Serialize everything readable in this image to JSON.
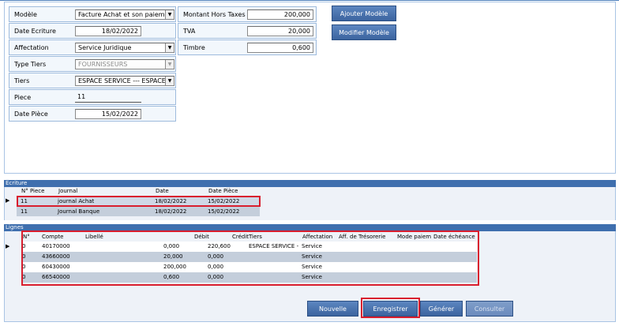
{
  "form": {
    "modele": {
      "label": "Modèle",
      "value": "Facture Achat et son paiement"
    },
    "date_ecriture": {
      "label": "Date Ecriture",
      "value": "18/02/2022"
    },
    "affectation": {
      "label": "Affectation",
      "value": "Service Juridique"
    },
    "type_tiers": {
      "label": "Type Tiers",
      "value": "FOURNISSEURS"
    },
    "tiers": {
      "label": "Tiers",
      "value": "ESPACE SERVICE --- ESPACE S"
    },
    "piece": {
      "label": "Piece",
      "value": "11"
    },
    "date_piece": {
      "label": "Date Pièce",
      "value": "15/02/2022"
    },
    "montant_ht": {
      "label": "Montant Hors Taxes",
      "value": "200,000"
    },
    "tva": {
      "label": "TVA",
      "value": "20,000"
    },
    "timbre": {
      "label": "Timbre",
      "value": "0,600"
    }
  },
  "buttons": {
    "ajouter_modele": "Ajouter Modèle",
    "modifier_modele": "Modifier Modèle",
    "nouvelle": "Nouvelle",
    "enregistrer": "Enregistrer",
    "generer": "Générer",
    "consulter": "Consulter"
  },
  "ecriture": {
    "title": "Ecriture",
    "columns": [
      "N° Piece",
      "Journal",
      "Date",
      "Date Pièce"
    ],
    "rows": [
      {
        "piece": "11",
        "journal": "journal Achat",
        "date": "18/02/2022",
        "date_piece": "15/02/2022"
      },
      {
        "piece": "11",
        "journal": "Journal Banque",
        "date": "18/02/2022",
        "date_piece": "15/02/2022"
      }
    ]
  },
  "lignes": {
    "title": "Lignes",
    "columns": [
      "N°",
      "Compte",
      "Libellé",
      "Débit",
      "Crédit",
      "Tiers",
      "Affectation",
      "Aff. de Trésorerie",
      "Mode paiem",
      "Date échéance"
    ],
    "rows": [
      {
        "n": "0",
        "compte": "40170000",
        "libelle": "",
        "debit": "0,000",
        "credit": "220,600",
        "tiers": "ESPACE SERVICE -",
        "affectation": "Service"
      },
      {
        "n": "0",
        "compte": "43660000",
        "libelle": "",
        "debit": "20,000",
        "credit": "0,000",
        "tiers": "",
        "affectation": "Service"
      },
      {
        "n": "0",
        "compte": "60430000",
        "libelle": "",
        "debit": "200,000",
        "credit": "0,000",
        "tiers": "",
        "affectation": "Service"
      },
      {
        "n": "0",
        "compte": "66540000",
        "libelle": "",
        "debit": "0,600",
        "credit": "0,000",
        "tiers": "",
        "affectation": "Service"
      }
    ]
  },
  "colors": {
    "accent": "#3f6fae",
    "highlight": "#d91e2e",
    "row_alt": "#c4cedb"
  },
  "icons": {
    "dropdown": "chevron-down-icon",
    "row_pointer": "row-pointer-icon"
  }
}
